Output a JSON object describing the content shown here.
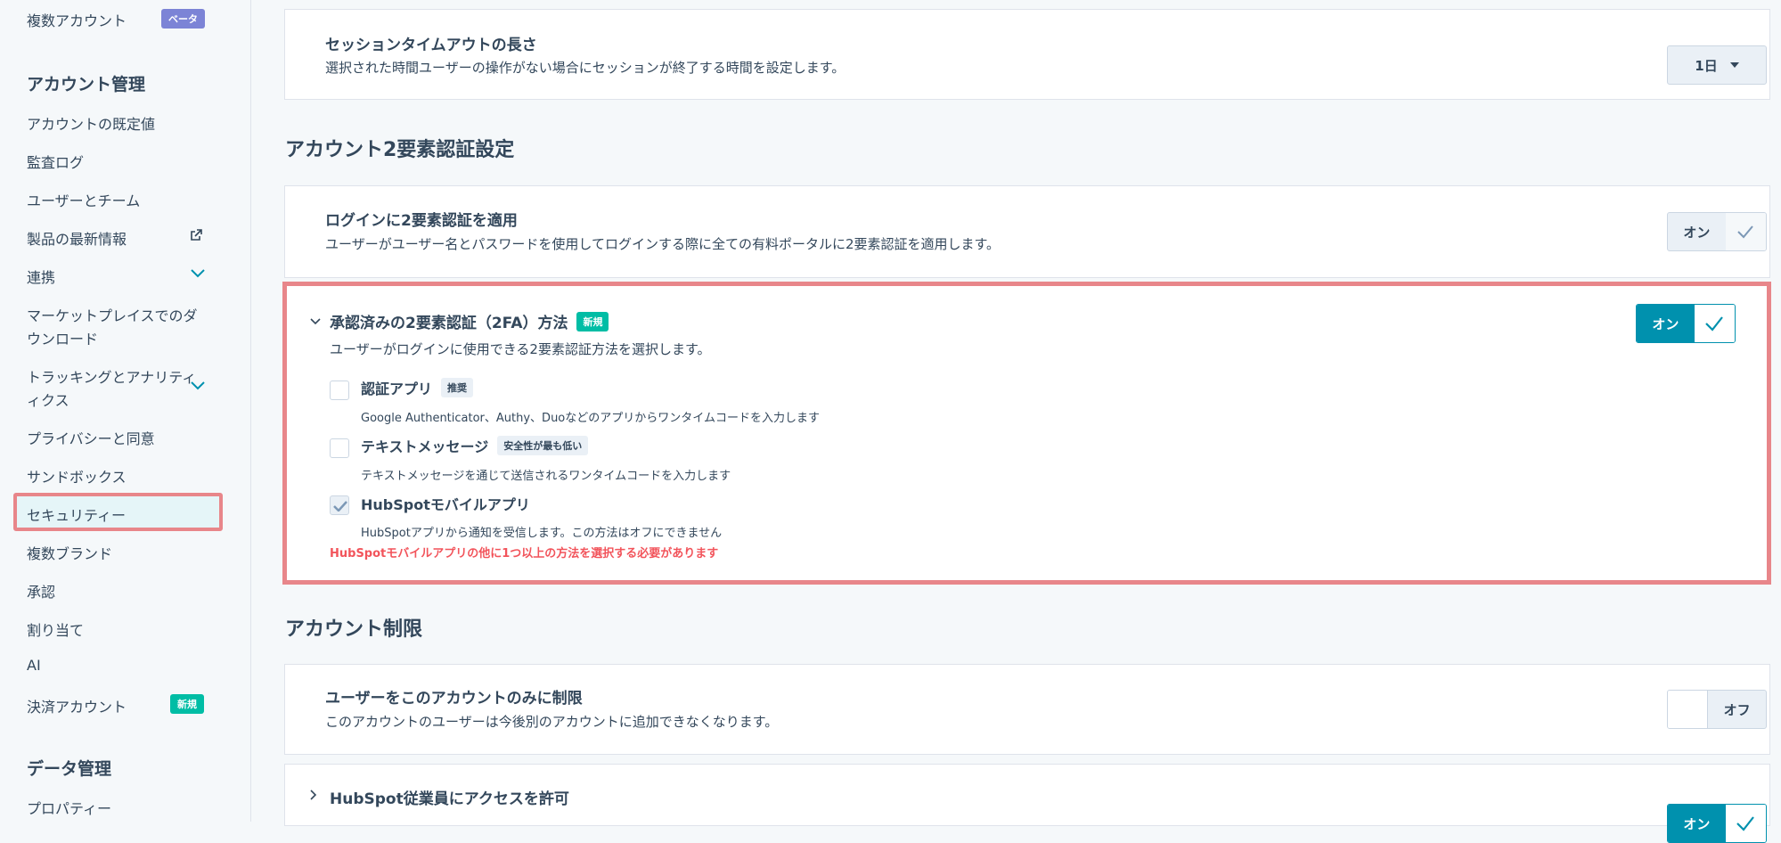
{
  "sidebar": {
    "multi_account": "複数アカウント",
    "beta_badge": "ベータ",
    "account_mgmt_heading": "アカウント管理",
    "items": [
      {
        "label": "アカウントの既定値"
      },
      {
        "label": "監査ログ"
      },
      {
        "label": "ユーザーとチーム"
      },
      {
        "label": "製品の最新情報"
      },
      {
        "label": "連携"
      },
      {
        "label": "マーケットプレイスでのダ"
      },
      {
        "label": "ウンロード"
      },
      {
        "label": "トラッキングとアナリティ"
      },
      {
        "label": "ィクス"
      },
      {
        "label": "プライバシーと同意"
      },
      {
        "label": "サンドボックス"
      },
      {
        "label": "セキュリティー"
      },
      {
        "label": "複数ブランド"
      },
      {
        "label": "承認"
      },
      {
        "label": "割り当て"
      },
      {
        "label": "AI"
      },
      {
        "label": "決済アカウント"
      }
    ],
    "new_badge": "新規",
    "data_mgmt_heading": "データ管理",
    "properties": "プロパティー"
  },
  "session": {
    "title": "セッションタイムアウトの長さ",
    "desc": "選択された時間ユーザーの操作がない場合にセッションが終了する時間を設定します。",
    "dropdown_value": "1日"
  },
  "twofa_section": {
    "heading": "アカウント2要素認証設定",
    "enforce_title": "ログインに2要素認証を適用",
    "enforce_desc": "ユーザーがユーザー名とパスワードを使用してログインする際に全ての有料ポータルに2要素認証を適用します。",
    "enforce_toggle": "オン"
  },
  "approved_methods": {
    "title": "承認済みの2要素認証（2FA）方法",
    "new_badge": "新規",
    "desc": "ユーザーがログインに使用できる2要素認証方法を選択します。",
    "toggle": "オン",
    "options": [
      {
        "title": "認証アプリ",
        "tag": "推奨",
        "desc": "Google Authenticator、Authy、Duoなどのアプリからワンタイムコードを入力します",
        "checked": false
      },
      {
        "title": "テキストメッセージ",
        "tag": "安全性が最も低い",
        "desc": "テキストメッセージを通じて送信されるワンタイムコードを入力します",
        "checked": false
      },
      {
        "title": "HubSpotモバイルアプリ",
        "tag": "",
        "desc": "HubSpotアプリから通知を受信します。この方法はオフにできません",
        "checked": true
      }
    ],
    "error": "HubSpotモバイルアプリの他に1つ以上の方法を選択する必要があります"
  },
  "restriction_section": {
    "heading": "アカウント制限",
    "restrict_title": "ユーザーをこのアカウントのみに制限",
    "restrict_desc": "このアカウントのユーザーは今後別のアカウントに追加できなくなります。",
    "restrict_toggle": "オフ",
    "hubspot_access_title": "HubSpot従業員にアクセスを許可",
    "hubspot_access_toggle": "オン"
  },
  "colors": {
    "teal": "#0091ae",
    "highlight_border": "#e8868a",
    "error": "#f2545b",
    "new_badge": "#00bda5",
    "beta_badge": "#7c84d6"
  }
}
